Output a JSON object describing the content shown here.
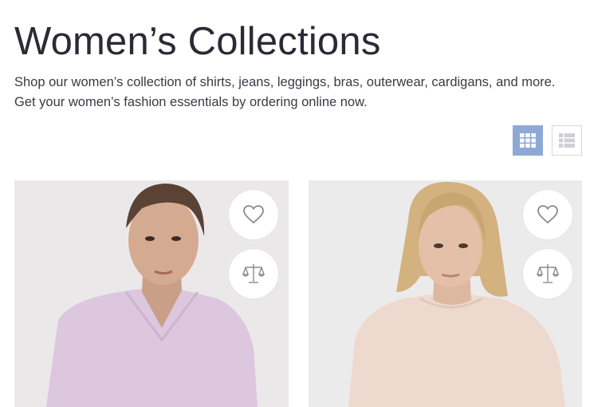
{
  "page": {
    "title": "Women’s Collections",
    "description": "Shop our women’s collection of shirts, jeans, leggings, bras, outerwear, cardigans, and more. Get your women’s fashion essentials by ordering online now."
  },
  "view_toggle": {
    "active": "grid",
    "active_color": "#8ea9d6",
    "icons": [
      "grid-view-icon",
      "list-view-icon"
    ]
  },
  "products": [
    {
      "sweater_color": "#dcc7de",
      "background": "#ebe8ea",
      "icons": [
        "heart-icon",
        "scale-icon"
      ]
    },
    {
      "sweater_color": "#eed9cf",
      "background": "#ecebec",
      "icons": [
        "heart-icon",
        "scale-icon"
      ]
    }
  ]
}
